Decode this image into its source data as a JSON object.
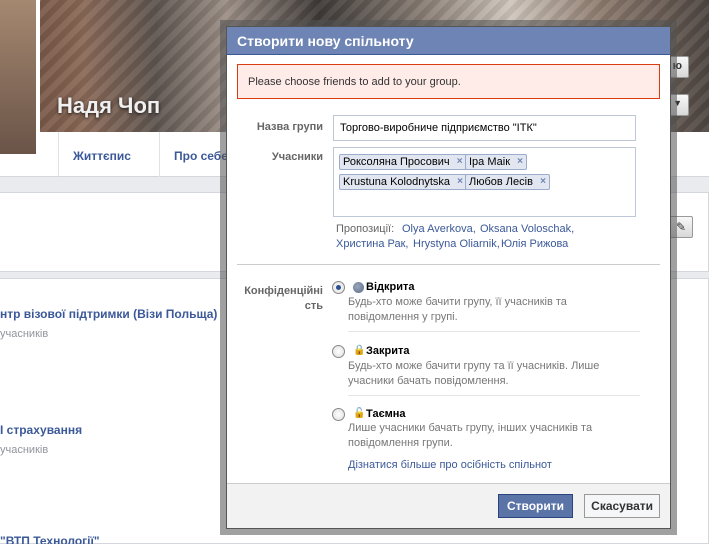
{
  "profile": {
    "name": "Надя Чоп"
  },
  "header_buttons": {
    "top_right_label": "ю",
    "menu_arrow": "▼"
  },
  "nav_tabs": [
    "Життєпис",
    "Про себе"
  ],
  "background_items": [
    {
      "title": "нтр візової підтримки (Візи Польща)",
      "subtitle": "учасників"
    },
    {
      "title": "І страхування",
      "subtitle": "учасників"
    },
    {
      "title": "\"ВТП Технології\"",
      "subtitle": ""
    }
  ],
  "dialog": {
    "title": "Створити нову спільноту",
    "error_message": "Please choose friends to add to your group.",
    "group_name_label": "Назва групи",
    "group_name_value": "Торгово-виробниче підприємство \"ІТК\"",
    "members_label": "Учасники",
    "members": [
      "Роксоляна Просович",
      "Іра Маік",
      "Krustuna Kolodnytska",
      "Любов Лесів"
    ],
    "remove_glyph": "×",
    "suggestions_label": "Пропозиції:",
    "suggestions": [
      "Olya Averkova,",
      "Oksana Voloschak,",
      "Христина Рак,",
      "Hrystyna Oliarnik,",
      "Юлія Рижова"
    ],
    "privacy_label": "Конфіденційні сть",
    "privacy_options": [
      {
        "title": "Відкрита",
        "description": "Будь-хто може бачити групу, її учасників та повідомлення у групі.",
        "selected": true,
        "icon": "globe-icon"
      },
      {
        "title": "Закрита",
        "description": "Будь-хто може бачити групу та її учасників. Лише учасники бачать повідомлення.",
        "selected": false,
        "icon": "lock-icon"
      },
      {
        "title": "Таємна",
        "description": "Лише учасники бачать групу, інших учасників та повідомлення групи.",
        "selected": false,
        "icon": "padlock-open-icon"
      }
    ],
    "learn_more": "Дізнатися більше про осібність спільнот",
    "create_button": "Створити",
    "cancel_button": "Скасувати"
  },
  "colors": {
    "header": "#6d84b4",
    "link": "#3b5998",
    "error_bg": "#ffebe8",
    "error_border": "#dd3c10",
    "primary_button": "#5b74a8"
  }
}
